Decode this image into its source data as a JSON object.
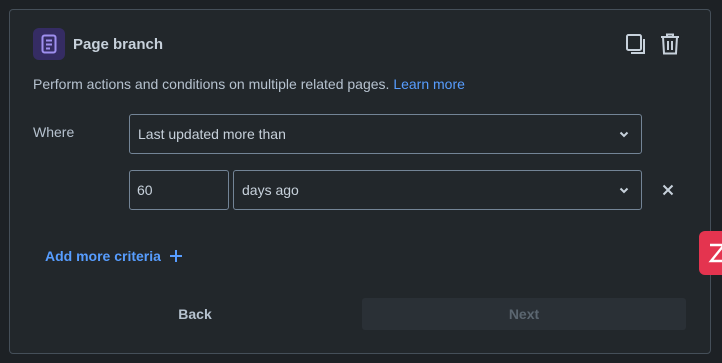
{
  "panel": {
    "title": "Page branch",
    "description": "Perform actions and conditions on multiple related pages.",
    "learn_more": "Learn more",
    "icons": {
      "branch": "page-icon",
      "copy": "copy-icon",
      "delete": "trash-icon"
    }
  },
  "where": {
    "label": "Where",
    "condition": "Last updated more than",
    "amount": "60",
    "unit": "days ago"
  },
  "add_criteria": "Add more criteria",
  "footer": {
    "back": "Back",
    "next": "Next"
  },
  "colors": {
    "accent": "#579dff",
    "badge": "#e4344f",
    "icon_bg": "#352c63"
  }
}
